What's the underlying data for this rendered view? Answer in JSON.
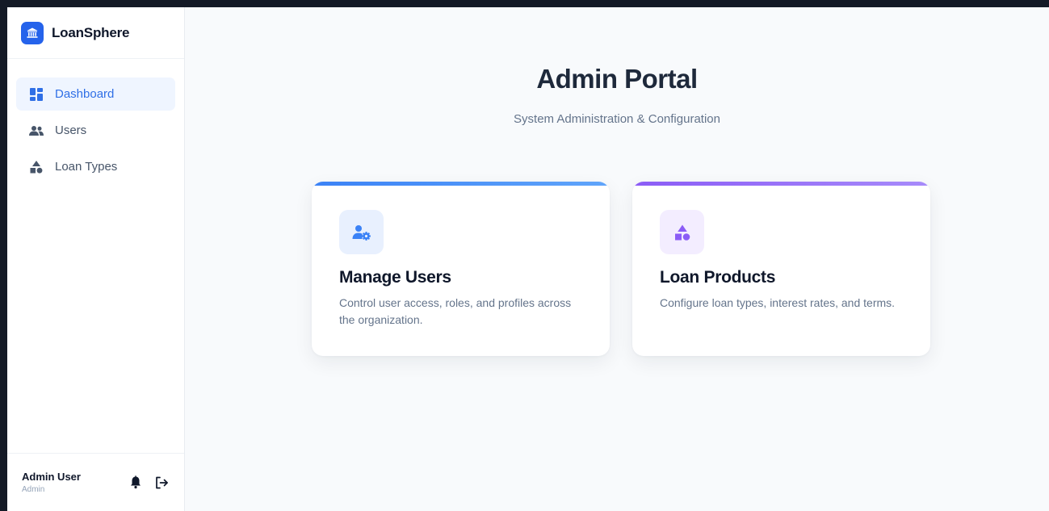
{
  "brand": {
    "name": "LoanSphere",
    "icon": "bank-icon",
    "color": "#2563eb"
  },
  "sidebar": {
    "items": [
      {
        "label": "Dashboard",
        "icon": "dashboard-icon",
        "active": true
      },
      {
        "label": "Users",
        "icon": "users-icon",
        "active": false
      },
      {
        "label": "Loan Types",
        "icon": "shapes-icon",
        "active": false
      }
    ],
    "footer": {
      "user_name": "Admin User",
      "user_role": "Admin",
      "notifications_icon": "bell-icon",
      "logout_icon": "logout-icon"
    }
  },
  "main": {
    "title": "Admin Portal",
    "subtitle": "System Administration & Configuration",
    "cards": [
      {
        "title": "Manage Users",
        "description": "Control user access, roles, and profiles across the organization.",
        "icon": "user-gear-icon",
        "accent": "#3b82f6"
      },
      {
        "title": "Loan Products",
        "description": "Configure loan types, interest rates, and terms.",
        "icon": "shapes-icon",
        "accent": "#8b5cf6"
      }
    ]
  }
}
